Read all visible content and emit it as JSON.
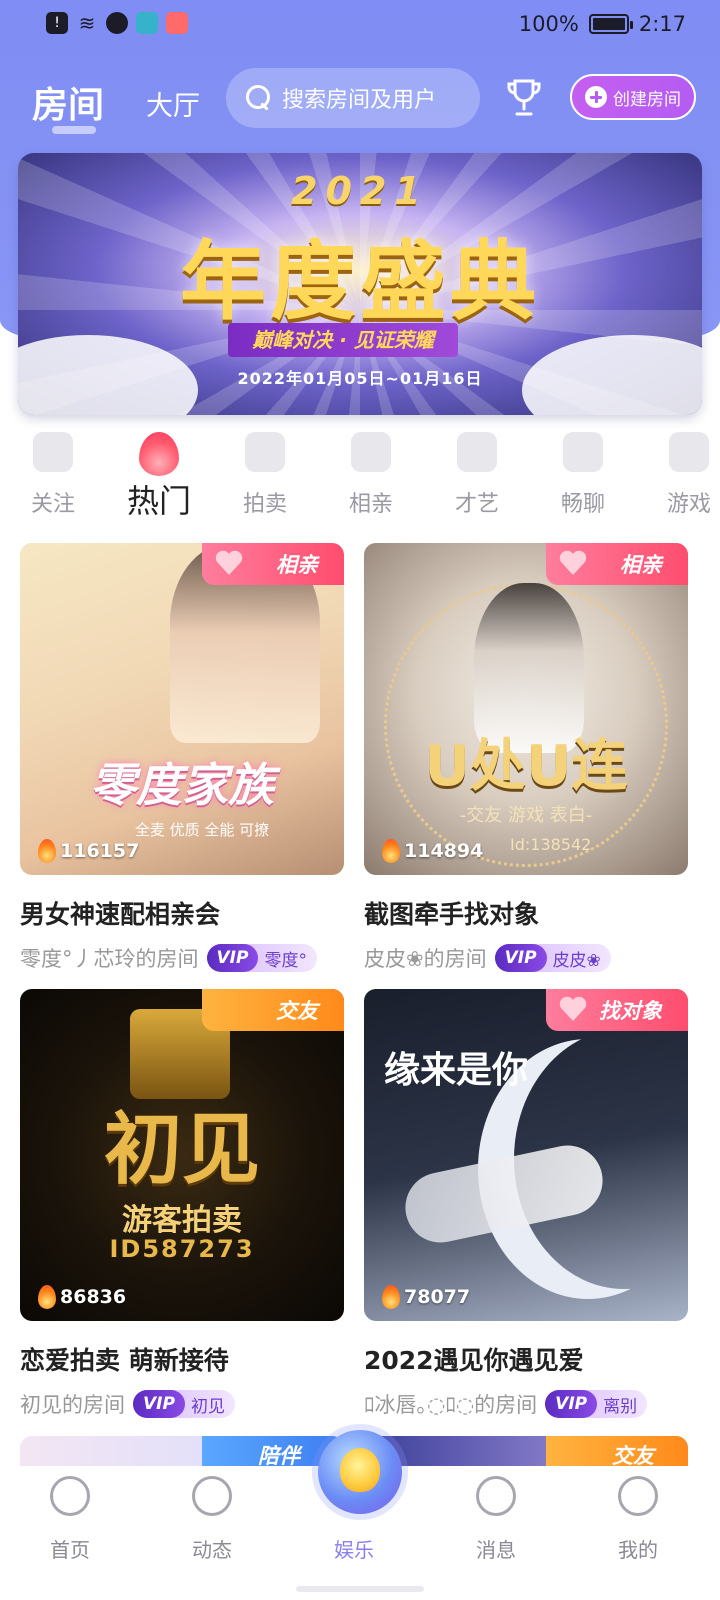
{
  "status_bar": {
    "battery": "100%",
    "time": "2:17"
  },
  "top_nav": {
    "tab_rooms": "房间",
    "tab_hall": "大厅",
    "search_placeholder": "搜索房间及用户",
    "create_room": "创建房间"
  },
  "banner": {
    "year": "2021",
    "title": "年度盛典",
    "slogan": "巅峰对决 · 见证荣耀",
    "dates": "2022年01月05日~01月16日"
  },
  "categories": [
    {
      "label": "关注",
      "icon": "heart-icon"
    },
    {
      "label": "热门",
      "icon": "flame-icon"
    },
    {
      "label": "拍卖",
      "icon": "hammer-icon"
    },
    {
      "label": "相亲",
      "icon": "couple-icon"
    },
    {
      "label": "才艺",
      "icon": "talent-icon"
    },
    {
      "label": "畅聊",
      "icon": "chat-icon"
    },
    {
      "label": "游戏",
      "icon": "gamepad-icon"
    }
  ],
  "rooms": [
    {
      "tag": "相亲",
      "cover_title": "零度家族",
      "cover_sub": "全麦  优质  全能  可撩",
      "heat": "116157",
      "title": "男女神速配相亲会",
      "owner": "零度°丿芯玲的房间",
      "vip_label": "VIP",
      "vip_name": "零度°"
    },
    {
      "tag": "相亲",
      "cover_title": "U处U连",
      "cover_sub": "-交友 游戏 表白-",
      "cover_id": "Id:138542",
      "heat": "114894",
      "title": "截图牵手找对象",
      "owner": "皮皮❀的房间",
      "vip_label": "VIP",
      "vip_name": "皮皮❀"
    },
    {
      "tag": "交友",
      "cover_title": "初见",
      "cover_sub": "游客拍卖",
      "cover_id": "ID587273",
      "heat": "86836",
      "title": "恋爱拍卖 萌新接待",
      "owner": "初见的房间",
      "vip_label": "VIP",
      "vip_name": "初见"
    },
    {
      "tag": "找对象",
      "cover_title": "缘来是你",
      "heat": "78077",
      "title": "2022遇见你遇见爱",
      "owner": "ﾛ冰唇｡◌ﾛ◌的房间",
      "vip_label": "VIP",
      "vip_name": "离别"
    }
  ],
  "peek_tags": [
    "陪伴",
    "交友"
  ],
  "bottom_nav": [
    {
      "label": "首页",
      "icon": "home-icon"
    },
    {
      "label": "动态",
      "icon": "planet-icon"
    },
    {
      "label": "娱乐",
      "icon": "entertainment-orb-icon"
    },
    {
      "label": "消息",
      "icon": "message-icon"
    },
    {
      "label": "我的",
      "icon": "profile-icon"
    }
  ],
  "colors": {
    "header": "#7f8df4",
    "accent": "#8a80f0",
    "tag_pink": "#ff4d6e",
    "tag_orange": "#ff8a1a",
    "create_button": "#b55cf2"
  }
}
